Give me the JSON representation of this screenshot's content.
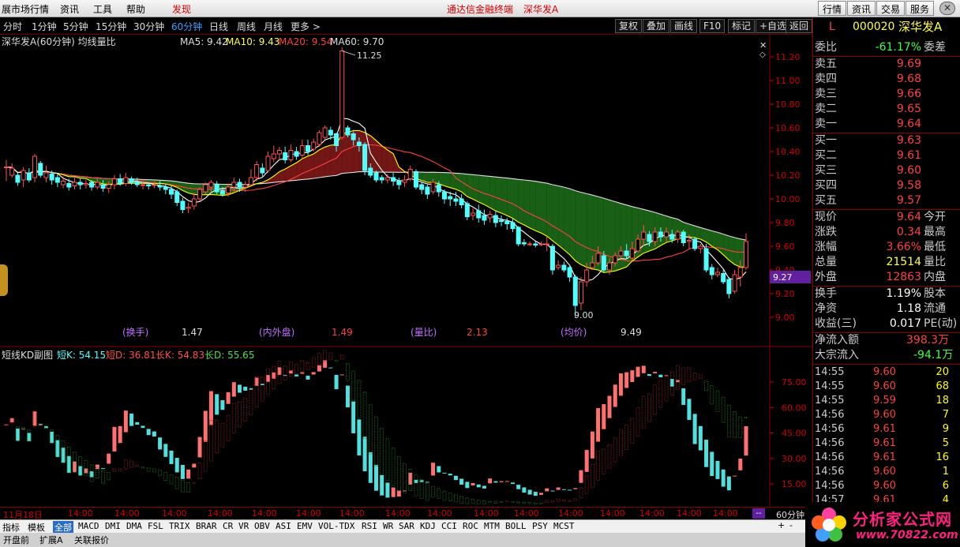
{
  "menu": {
    "items": [
      "展市场行情",
      "资讯",
      "工具",
      "帮助",
      "发现"
    ],
    "center_links": [
      "通达信金融终端",
      "深华发A"
    ],
    "right_buttons": [
      "行情",
      "资讯",
      "交易",
      "服务"
    ],
    "close": "✕"
  },
  "periods": {
    "items": [
      "分时",
      "1分钟",
      "5分钟",
      "15分钟",
      "30分钟",
      "60分钟",
      "日线",
      "周线",
      "月线",
      "更多 >"
    ],
    "active": "60分钟",
    "tools": [
      "复权",
      "叠加",
      "画线",
      "F10",
      "标记",
      "+自选",
      "返回"
    ]
  },
  "main_chart": {
    "title": "深华发A(60分钟) 均线量比",
    "ma_labels": [
      "MA5: 9.42",
      "MA10: 9.43",
      "MA20: 9.54",
      "MA60: 9.70"
    ],
    "high_label": "11.25",
    "low_label": "9.00",
    "current_price_tag": "9.27",
    "indicators": [
      {
        "label": "(换手)",
        "value": "1.47"
      },
      {
        "label": "(内外盘)",
        "value": "1.49"
      },
      {
        "label": "(量比)",
        "value": "2.13"
      },
      {
        "label": "(均价)",
        "value": "9.49"
      }
    ],
    "y_ticks": [
      "11.20",
      "11.00",
      "10.80",
      "10.60",
      "10.40",
      "10.20",
      "10.00",
      "9.80",
      "9.60",
      "9.40",
      "9.20",
      "9.00"
    ]
  },
  "kd_chart": {
    "title": "短线KD副图",
    "labels": [
      "短K: 54.15",
      "短D: 36.81",
      "长K: 54.83",
      "长D: 55.65"
    ],
    "y_ticks": [
      "75.00",
      "60.00",
      "45.00",
      "30.00",
      "15.00"
    ]
  },
  "x_axis": {
    "labels": [
      "11月18日",
      "14:00",
      "14:00",
      "14:00",
      "14:00",
      "14:00",
      "14:00",
      "14:00",
      "14:00",
      "14:00",
      "14:00",
      "14:00",
      "14:00",
      "14:00",
      "14:00",
      "14:00",
      "14:00",
      "14:00"
    ],
    "period": "60分钟"
  },
  "quote": {
    "code": "000020",
    "name": "深华发A",
    "flag": "L",
    "weibi_label": "委比",
    "weibi_value": "-61.17%",
    "weicha_label": "委差",
    "asks": [
      {
        "label": "卖五",
        "price": "9.69"
      },
      {
        "label": "卖四",
        "price": "9.68"
      },
      {
        "label": "卖三",
        "price": "9.66"
      },
      {
        "label": "卖二",
        "price": "9.65"
      },
      {
        "label": "卖一",
        "price": "9.64"
      }
    ],
    "bids": [
      {
        "label": "买一",
        "price": "9.63"
      },
      {
        "label": "买二",
        "price": "9.61"
      },
      {
        "label": "买三",
        "price": "9.60"
      },
      {
        "label": "买四",
        "price": "9.58"
      },
      {
        "label": "买五",
        "price": "9.57"
      }
    ],
    "stats": [
      {
        "label": "现价",
        "value": "9.64",
        "color": "#ff4040",
        "label2": "今开"
      },
      {
        "label": "涨跌",
        "value": "0.34",
        "color": "#ff4040",
        "label2": "最高"
      },
      {
        "label": "涨幅",
        "value": "3.66%",
        "color": "#ff4040",
        "label2": "最低"
      },
      {
        "label": "总量",
        "value": "21514",
        "color": "#ffff00",
        "label2": "量比"
      },
      {
        "label": "外盘",
        "value": "12863",
        "color": "#ff4040",
        "label2": "内盘"
      }
    ],
    "stats2": [
      {
        "label": "换手",
        "value": "1.19%",
        "color": "#ffffff",
        "label2": "股本"
      },
      {
        "label": "净资",
        "value": "1.18",
        "color": "#ffffff",
        "label2": "流通"
      },
      {
        "label": "收益(三)",
        "value": "0.017",
        "color": "#ffffff",
        "label2": "PE(动)"
      }
    ],
    "flow": [
      {
        "label": "净流入额",
        "value": "398.3万",
        "color": "#ff4040"
      },
      {
        "label": "大宗流入",
        "value": "-94.1万",
        "color": "#40ff40"
      }
    ],
    "ticks": [
      {
        "time": "14:55",
        "price": "9.60",
        "vol": "20"
      },
      {
        "time": "14:55",
        "price": "9.60",
        "vol": "68"
      },
      {
        "time": "14:55",
        "price": "9.59",
        "vol": "18"
      },
      {
        "time": "14:56",
        "price": "9.60",
        "vol": "7"
      },
      {
        "time": "14:56",
        "price": "9.61",
        "vol": "9"
      },
      {
        "time": "14:56",
        "price": "9.61",
        "vol": "5"
      },
      {
        "time": "14:56",
        "price": "9.61",
        "vol": "16"
      },
      {
        "time": "14:56",
        "price": "9.60",
        "vol": "1"
      },
      {
        "time": "14:56",
        "price": "9.60",
        "vol": "6"
      },
      {
        "time": "14:57",
        "price": "9.61",
        "vol": "4"
      }
    ]
  },
  "bottom_tabs": [
    "指标",
    "模板",
    "全部",
    "MACD",
    "DMI",
    "DMA",
    "FSL",
    "TRIX",
    "BRAR",
    "CR",
    "VR",
    "OBV",
    "ASI",
    "EMV",
    "VOL-TDX",
    "RSI",
    "WR",
    "SAR",
    "KDJ",
    "CCI",
    "ROC",
    "MTM",
    "BOLL",
    "PSY",
    "MCST"
  ],
  "bottom_tabs2": [
    "开盘前",
    "扩展A",
    "关联报价"
  ],
  "bottom_right": [
    "+",
    "-"
  ],
  "logo_text": "分析家公式网",
  "logo_url": "www.70822.com",
  "colors": {
    "up": "#ff5050",
    "down": "#50ffff",
    "ma5": "#ffffff",
    "ma10": "#ffff00",
    "ma20": "#ff4040",
    "ma60": "#e0e0e0",
    "accent": "#3ba0ff"
  },
  "candles": [
    [
      10.27,
      10.27,
      10.33,
      10.15
    ],
    [
      10.2,
      10.26,
      10.3,
      10.18
    ],
    [
      10.2,
      10.14,
      10.22,
      10.11
    ],
    [
      10.16,
      10.24,
      10.27,
      10.1
    ],
    [
      10.22,
      10.16,
      10.26,
      10.14
    ],
    [
      10.18,
      10.36,
      10.38,
      10.14
    ],
    [
      10.3,
      10.2,
      10.32,
      10.18
    ],
    [
      10.18,
      10.22,
      10.28,
      10.14
    ],
    [
      10.21,
      10.16,
      10.24,
      10.12
    ],
    [
      10.18,
      10.14,
      10.21,
      10.1
    ],
    [
      10.12,
      10.15,
      10.19,
      10.09
    ],
    [
      10.13,
      10.1,
      10.17,
      10.07
    ],
    [
      10.11,
      10.14,
      10.18,
      10.08
    ],
    [
      10.14,
      10.12,
      10.17,
      10.08
    ],
    [
      10.12,
      10.13,
      10.16,
      10.09
    ],
    [
      10.14,
      10.1,
      10.16,
      10.07
    ],
    [
      10.1,
      10.14,
      10.18,
      10.08
    ],
    [
      10.12,
      10.09,
      10.16,
      10.06
    ],
    [
      10.09,
      10.12,
      10.15,
      10.05
    ],
    [
      10.12,
      10.17,
      10.2,
      10.08
    ],
    [
      10.17,
      10.13,
      10.21,
      10.11
    ],
    [
      10.13,
      10.18,
      10.22,
      10.11
    ],
    [
      10.17,
      10.14,
      10.19,
      10.12
    ],
    [
      10.14,
      10.12,
      10.18,
      10.1
    ],
    [
      10.12,
      10.12,
      10.15,
      10.08
    ],
    [
      10.12,
      10.11,
      10.14,
      10.08
    ],
    [
      10.12,
      10.12,
      10.15,
      10.09
    ],
    [
      10.11,
      10.1,
      10.15,
      10.07
    ],
    [
      10.1,
      10.08,
      10.13,
      10.04
    ],
    [
      10.08,
      10.04,
      10.11,
      10.0
    ],
    [
      10.06,
      9.97,
      10.08,
      9.94
    ],
    [
      9.98,
      9.91,
      10.01,
      9.88
    ],
    [
      9.92,
      9.93,
      9.97,
      9.88
    ],
    [
      9.94,
      10.0,
      10.05,
      9.91
    ],
    [
      10.0,
      10.08,
      10.1,
      9.98
    ],
    [
      10.06,
      10.12,
      10.14,
      10.04
    ],
    [
      10.1,
      10.14,
      10.16,
      10.06
    ],
    [
      10.12,
      10.06,
      10.15,
      10.04
    ],
    [
      10.07,
      10.04,
      10.1,
      10.02
    ],
    [
      10.05,
      10.1,
      10.13,
      10.02
    ],
    [
      10.1,
      10.14,
      10.18,
      10.06
    ],
    [
      10.14,
      10.1,
      10.17,
      10.06
    ],
    [
      10.1,
      10.12,
      10.15,
      10.06
    ],
    [
      10.12,
      10.18,
      10.25,
      10.11
    ],
    [
      10.18,
      10.29,
      10.32,
      10.15
    ],
    [
      10.26,
      10.22,
      10.3,
      10.19
    ],
    [
      10.24,
      10.36,
      10.4,
      10.22
    ],
    [
      10.34,
      10.38,
      10.45,
      10.31
    ],
    [
      10.38,
      10.41,
      10.44,
      10.33
    ],
    [
      10.39,
      10.33,
      10.44,
      10.3
    ],
    [
      10.33,
      10.41,
      10.46,
      10.31
    ],
    [
      10.4,
      10.36,
      10.44,
      10.33
    ],
    [
      10.37,
      10.45,
      10.5,
      10.34
    ],
    [
      10.45,
      10.4,
      10.5,
      10.37
    ],
    [
      10.42,
      10.48,
      10.51,
      10.4
    ],
    [
      10.46,
      10.56,
      10.58,
      10.44
    ],
    [
      10.52,
      10.6,
      10.62,
      10.5
    ],
    [
      10.58,
      10.54,
      10.61,
      10.5
    ],
    [
      10.55,
      10.45,
      10.56,
      10.4
    ],
    [
      10.52,
      11.25,
      11.28,
      10.5
    ],
    [
      10.6,
      10.54,
      10.62,
      10.52
    ],
    [
      10.55,
      10.5,
      10.57,
      10.45
    ],
    [
      10.48,
      10.45,
      10.52,
      10.4
    ],
    [
      10.46,
      10.24,
      10.48,
      10.2
    ],
    [
      10.26,
      10.2,
      10.3,
      10.18
    ],
    [
      10.22,
      10.16,
      10.24,
      10.14
    ],
    [
      10.18,
      10.16,
      10.2,
      10.13
    ],
    [
      10.16,
      10.18,
      10.21,
      10.13
    ],
    [
      10.18,
      10.15,
      10.22,
      10.11
    ],
    [
      10.15,
      10.12,
      10.18,
      10.08
    ],
    [
      10.14,
      10.16,
      10.2,
      10.1
    ],
    [
      10.17,
      10.25,
      10.28,
      10.15
    ],
    [
      10.23,
      10.1,
      10.25,
      10.08
    ],
    [
      10.12,
      10.08,
      10.14,
      10.04
    ],
    [
      10.1,
      10.04,
      10.12,
      10.0
    ],
    [
      10.06,
      10.14,
      10.17,
      10.04
    ],
    [
      10.12,
      10.06,
      10.15,
      10.02
    ],
    [
      10.06,
      10.0,
      10.08,
      9.96
    ],
    [
      10.02,
      10.0,
      10.06,
      9.94
    ],
    [
      10.0,
      9.98,
      10.06,
      9.94
    ],
    [
      10.0,
      9.95,
      10.04,
      9.92
    ],
    [
      9.96,
      9.85,
      9.98,
      9.82
    ],
    [
      9.86,
      9.88,
      9.92,
      9.82
    ],
    [
      9.9,
      9.84,
      9.95,
      9.8
    ],
    [
      9.86,
      9.82,
      9.91,
      9.78
    ],
    [
      9.84,
      9.87,
      9.9,
      9.8
    ],
    [
      9.86,
      9.8,
      9.9,
      9.76
    ],
    [
      9.82,
      9.81,
      9.86,
      9.77
    ],
    [
      9.81,
      9.79,
      9.84,
      9.74
    ],
    [
      9.8,
      9.75,
      9.84,
      9.72
    ],
    [
      9.76,
      9.62,
      9.77,
      9.6
    ],
    [
      9.63,
      9.62,
      9.66,
      9.6
    ],
    [
      9.62,
      9.62,
      9.64,
      9.6
    ],
    [
      9.62,
      9.61,
      9.64,
      9.59
    ],
    [
      9.62,
      9.62,
      9.64,
      9.6
    ],
    [
      9.62,
      9.62,
      9.68,
      9.56
    ],
    [
      9.6,
      9.4,
      9.62,
      9.36
    ],
    [
      9.42,
      9.44,
      9.48,
      9.4
    ],
    [
      9.44,
      9.4,
      9.47,
      9.38
    ],
    [
      9.42,
      9.34,
      9.44,
      9.3
    ],
    [
      9.34,
      9.1,
      9.36,
      9.0
    ],
    [
      9.12,
      9.3,
      9.34,
      9.06
    ],
    [
      9.3,
      9.4,
      9.46,
      9.26
    ],
    [
      9.42,
      9.46,
      9.52,
      9.4
    ],
    [
      9.46,
      9.54,
      9.6,
      9.44
    ],
    [
      9.52,
      9.4,
      9.56,
      9.38
    ],
    [
      9.4,
      9.46,
      9.5,
      9.36
    ],
    [
      9.46,
      9.52,
      9.55,
      9.43
    ],
    [
      9.52,
      9.56,
      9.6,
      9.48
    ],
    [
      9.56,
      9.52,
      9.62,
      9.49
    ],
    [
      9.5,
      9.58,
      9.64,
      9.48
    ],
    [
      9.56,
      9.66,
      9.7,
      9.55
    ],
    [
      9.66,
      9.72,
      9.78,
      9.6
    ],
    [
      9.7,
      9.64,
      9.73,
      9.6
    ],
    [
      9.64,
      9.72,
      9.76,
      9.6
    ],
    [
      9.72,
      9.68,
      9.76,
      9.64
    ],
    [
      9.68,
      9.72,
      9.76,
      9.64
    ],
    [
      9.7,
      9.66,
      9.74,
      9.63
    ],
    [
      9.66,
      9.72,
      9.74,
      9.63
    ],
    [
      9.72,
      9.63,
      9.74,
      9.6
    ],
    [
      9.64,
      9.65,
      9.7,
      9.58
    ],
    [
      9.66,
      9.58,
      9.68,
      9.56
    ],
    [
      9.58,
      9.6,
      9.62,
      9.54
    ],
    [
      9.58,
      9.4,
      9.62,
      9.38
    ],
    [
      9.42,
      9.36,
      9.45,
      9.32
    ],
    [
      9.36,
      9.38,
      9.42,
      9.34
    ],
    [
      9.37,
      9.3,
      9.4,
      9.28
    ],
    [
      9.32,
      9.2,
      9.34,
      9.16
    ],
    [
      9.22,
      9.36,
      9.4,
      9.2
    ],
    [
      9.34,
      9.42,
      9.48,
      9.26
    ],
    [
      9.42,
      9.64,
      9.71,
      9.4
    ]
  ]
}
